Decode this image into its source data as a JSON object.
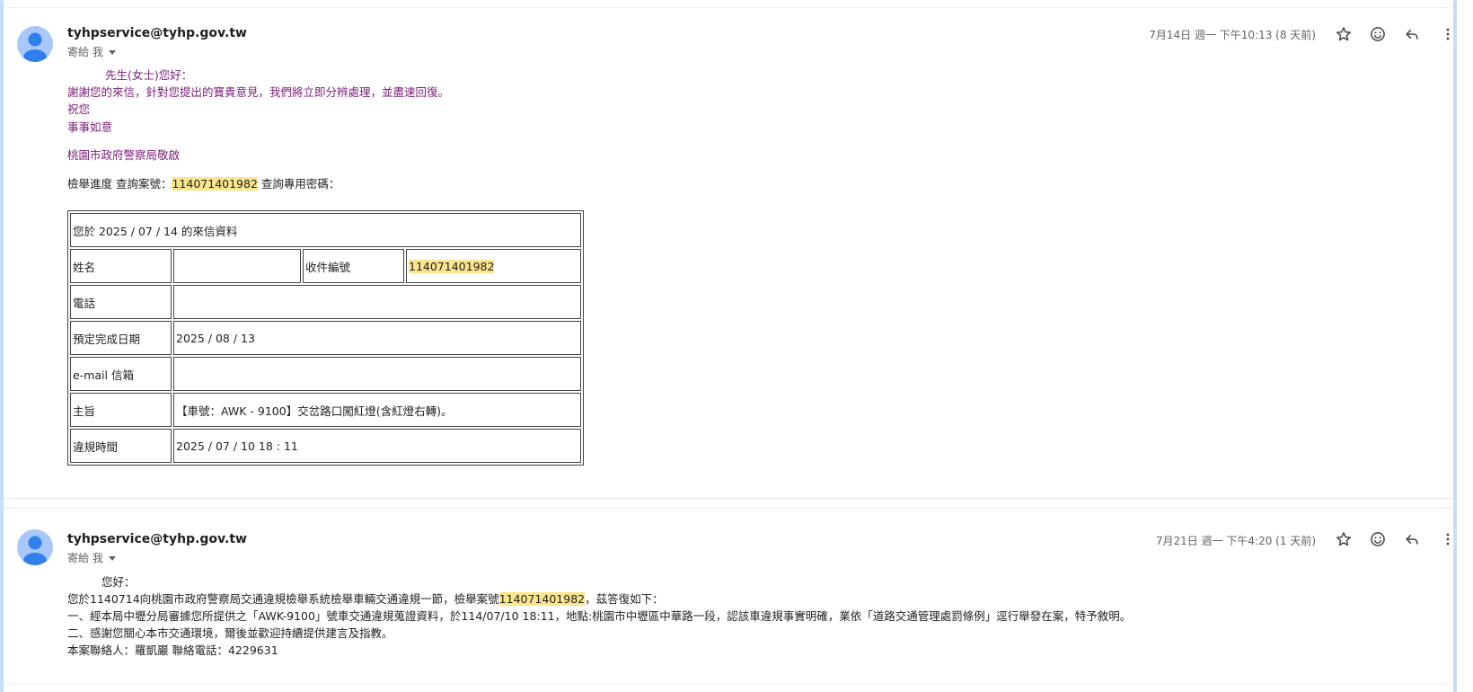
{
  "messages": [
    {
      "sender": "tyhpservice@tyhp.gov.tw",
      "recipient": "寄給 我",
      "date": "7月14日 週一 下午10:13 (8 天前)",
      "greeting": "先生(女士)您好：",
      "thanks": "謝謝您的來信，針對您提出的寶貴意見，我們將立即分辨處理，並盡速回復。",
      "wish1": "祝您",
      "wish2": "事事如意",
      "signature": "桃園市政府警察局敬啟",
      "progress_prefix": "檢舉進度 查詢案號：",
      "case_number": "114071401982",
      "progress_suffix": " 查詢專用密碼：",
      "table": {
        "header": "您於 2025 / 07 / 14 的來信資料",
        "name_label": "姓名",
        "name_value": "",
        "receipt_label": "收件編號",
        "receipt_value": "114071401982",
        "phone_label": "電話",
        "phone_value": "",
        "due_label": "預定完成日期",
        "due_value": "2025 / 08 / 13",
        "email_label": "e-mail 信箱",
        "email_value": "",
        "subject_label": "主旨",
        "subject_value": "【車號：AWK - 9100】交岔路口闖紅燈(含紅燈右轉)。",
        "time_label": "違規時間",
        "time_value": "2025 / 07 / 10 18 : 11"
      }
    },
    {
      "sender": "tyhpservice@tyhp.gov.tw",
      "recipient": "寄給 我",
      "date": "7月21日 週一 下午4:20 (1 天前)",
      "greeting": "您好：",
      "line1_prefix": "您於1140714向桃園市政府警察局交通違規檢舉系統檢舉車輛交通違規一節，檢舉案號",
      "case_number": "114071401982",
      "line1_suffix": "，茲答復如下：",
      "line2": "一、經本局中壢分局審據您所提供之「AWK-9100」號車交通違規蒐證資料，於114/07/10 18:11，地點:桃園市中壢區中華路一段，認該車違規事實明確，業依「道路交通管理處罰條例」逕行舉發在案，特予敘明。",
      "line3": "二、感謝您關心本市交通環境，爾後並歡迎持續提供建言及指教。",
      "line4": "本案聯絡人：羅凱巖 聯絡電話：4229631"
    }
  ],
  "icons": [
    "star-icon",
    "emoji-icon",
    "reply-icon",
    "more-vert-icon",
    "avatar-person-icon"
  ]
}
